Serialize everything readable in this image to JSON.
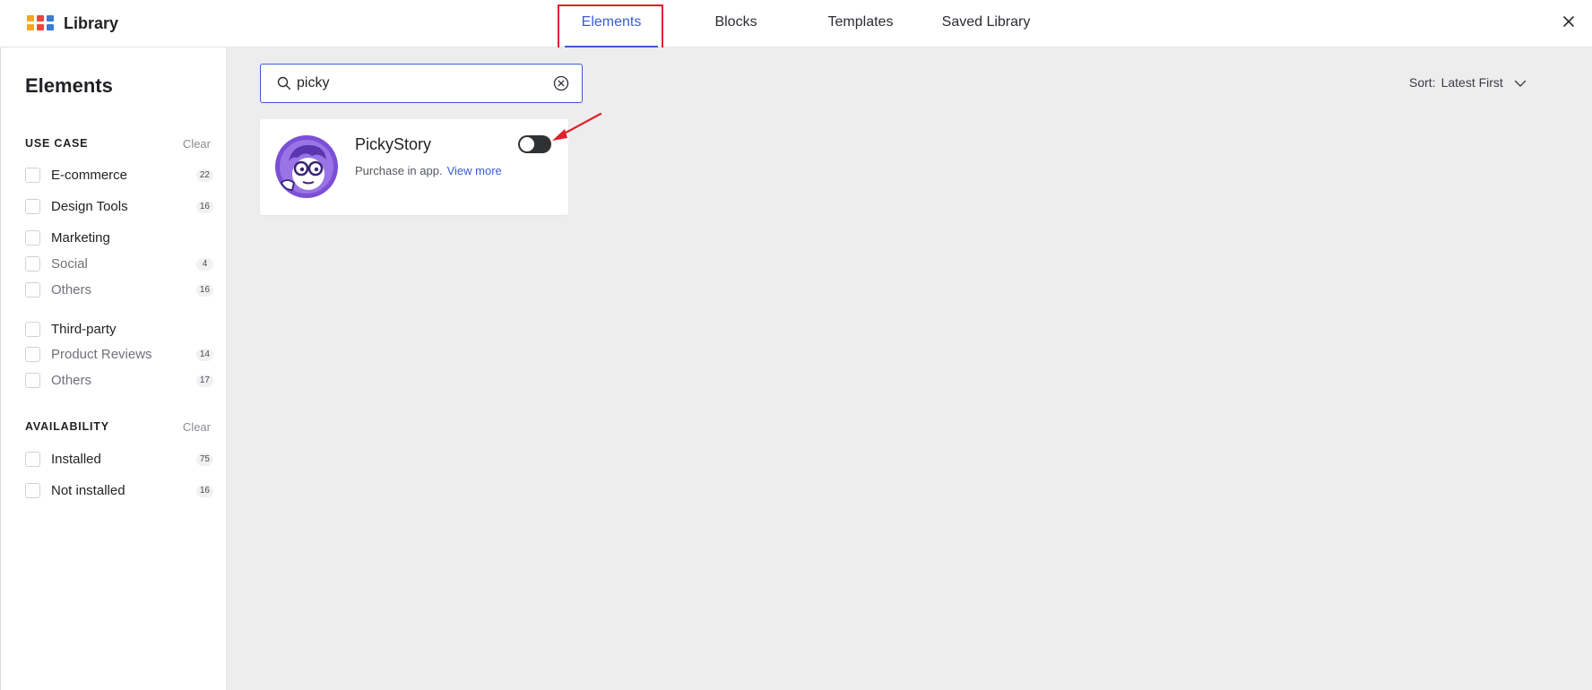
{
  "app": {
    "title": "Library",
    "logo_colors": [
      "#f5a623",
      "#e8483a",
      "#3a7bd5",
      "#f5a623",
      "#e8483a",
      "#3a7bd5"
    ]
  },
  "tabs": [
    {
      "label": "Elements",
      "active": true
    },
    {
      "label": "Blocks",
      "active": false
    },
    {
      "label": "Templates",
      "active": false
    },
    {
      "label": "Saved Library",
      "active": false
    }
  ],
  "sidebar": {
    "title": "Elements",
    "use_case": {
      "heading": "USE CASE",
      "clear_label": "Clear",
      "options": [
        {
          "label": "E-commerce",
          "count": "22"
        },
        {
          "label": "Design Tools",
          "count": "16"
        },
        {
          "label": "Marketing",
          "count": ""
        },
        {
          "label": "Social",
          "count": "4"
        },
        {
          "label": "Others",
          "count": "16"
        },
        {
          "label": "Third-party",
          "count": ""
        },
        {
          "label": "Product Reviews",
          "count": "14"
        },
        {
          "label": "Others",
          "count": "17"
        }
      ]
    },
    "availability": {
      "heading": "AVAILABILITY",
      "clear_label": "Clear",
      "options": [
        {
          "label": "Installed",
          "count": "75"
        },
        {
          "label": "Not installed",
          "count": "16"
        }
      ]
    }
  },
  "search": {
    "value": "picky"
  },
  "sort": {
    "label": "Sort:",
    "value": "Latest First"
  },
  "results": [
    {
      "title": "PickyStory",
      "description": "Purchase in app.",
      "link_label": "View more",
      "enabled": false
    }
  ],
  "colors": {
    "accent": "#3a5bd9",
    "highlight": "#e0202a",
    "avatar": "#7b4fd6"
  }
}
